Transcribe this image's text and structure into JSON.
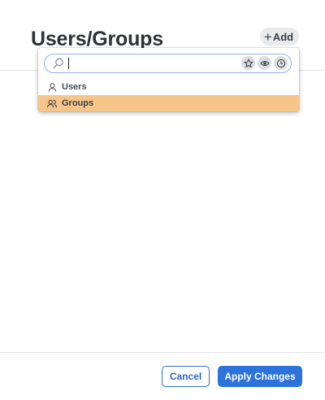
{
  "header": {
    "title": "Users/Groups",
    "add_label": "Add"
  },
  "dropdown": {
    "search": {
      "value": "",
      "placeholder": ""
    },
    "items": [
      {
        "label": "Users",
        "icon": "user-icon",
        "highlighted": false
      },
      {
        "label": "Groups",
        "icon": "group-icon",
        "highlighted": true
      }
    ],
    "filter_icons": [
      "star-icon",
      "eye-icon",
      "clock-icon"
    ]
  },
  "footer": {
    "cancel_label": "Cancel",
    "apply_label": "Apply Changes"
  },
  "colors": {
    "accent": "#2d73dc",
    "highlight": "#f5c58a"
  }
}
